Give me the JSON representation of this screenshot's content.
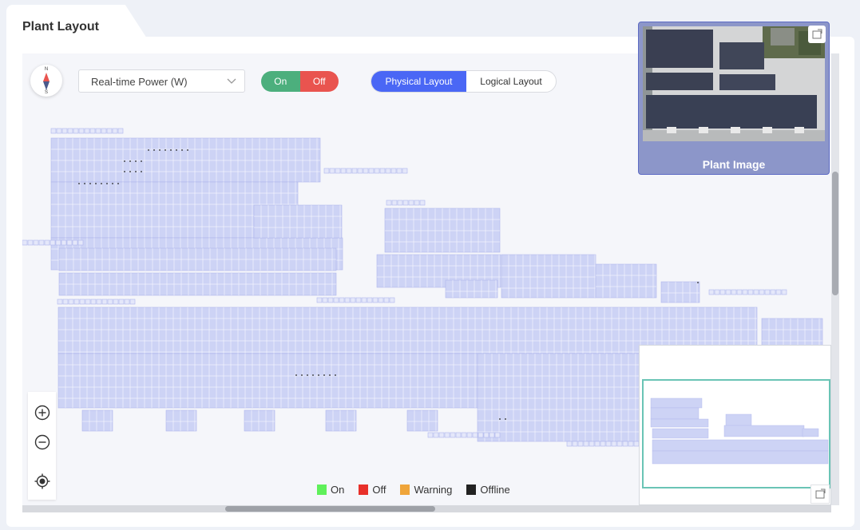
{
  "page": {
    "title": "Plant Layout"
  },
  "toolbar": {
    "compass_n": "N",
    "compass_s": "S",
    "metric_select": "Real-time Power (W)",
    "toggle_on": "On",
    "toggle_off": "Off",
    "layout_physical": "Physical Layout",
    "layout_logical": "Logical Layout",
    "active_layout": "Physical Layout"
  },
  "plant_image": {
    "caption": "Plant Image"
  },
  "legend": [
    {
      "label": "On",
      "color": "#5ff05a"
    },
    {
      "label": "Off",
      "color": "#e8302a"
    },
    {
      "label": "Warning",
      "color": "#efa53a"
    },
    {
      "label": "Offline",
      "color": "#222222"
    }
  ],
  "colors": {
    "panel_fill": "#cdd3f5",
    "panel_grid": "#aeb6ec",
    "accent": "#4a67f5",
    "minimap_viewport": "#6ac4b5"
  },
  "icons": {
    "zoom_in": "zoom-in-icon",
    "zoom_out": "zoom-out-icon",
    "locate": "locate-icon",
    "expand": "expand-icon",
    "chevron": "chevron-down-icon",
    "compass": "compass-icon"
  }
}
